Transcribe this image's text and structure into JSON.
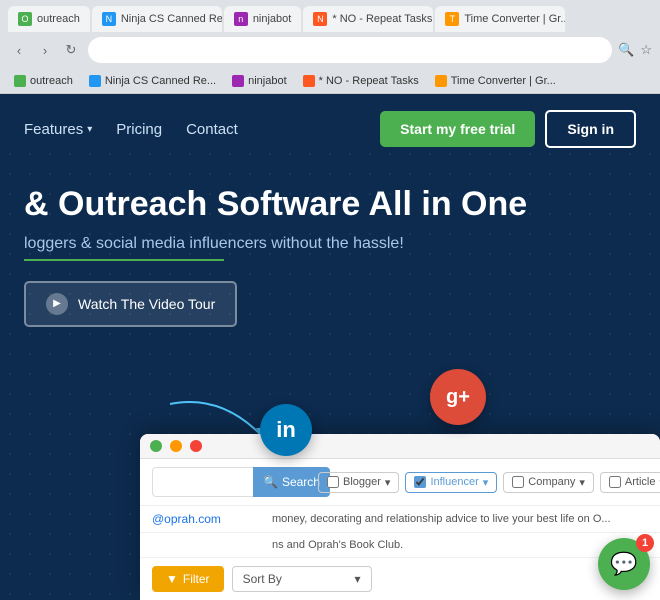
{
  "browser": {
    "tabs": [
      {
        "label": "outreach",
        "favicon_color": "#4caf50",
        "favicon_text": "O"
      },
      {
        "label": "Ninja CS Canned Re...",
        "favicon_color": "#2196f3",
        "favicon_text": "N"
      },
      {
        "label": "ninjabot",
        "favicon_color": "#9c27b0",
        "favicon_text": "n"
      },
      {
        "label": "* NO - Repeat Tasks",
        "favicon_color": "#ff5722",
        "favicon_text": "N"
      },
      {
        "label": "Time Converter | Gr...",
        "favicon_color": "#ff9800",
        "favicon_text": "T"
      }
    ],
    "omnibox_icons": [
      "🔍",
      "★"
    ]
  },
  "bookmarks": [
    {
      "label": "Ninja CS Canned Re...",
      "color": "#4caf50"
    },
    {
      "label": "ninjabot",
      "color": "#9c27b0"
    },
    {
      "label": "* NO - Repeat Tasks",
      "color": "#ff5722"
    },
    {
      "label": "Time Converter | Gr...",
      "color": "#ff9800"
    }
  ],
  "nav": {
    "features_label": "Features",
    "pricing_label": "Pricing",
    "contact_label": "Contact",
    "trial_btn": "Start my free trial",
    "signin_btn": "Sign in"
  },
  "hero": {
    "title": "& Outreach Software All in One",
    "subtitle": "loggers & social media influencers without the hassle!",
    "video_tour_btn": "Watch The Video Tour"
  },
  "dashboard": {
    "search_btn": "Search",
    "filter_btn": "Filter",
    "sort_label": "Sort By",
    "filters": [
      {
        "label": "Blogger",
        "active": false
      },
      {
        "label": "Influencer",
        "active": true
      },
      {
        "label": "Company",
        "active": false
      },
      {
        "label": "Article",
        "active": false
      }
    ],
    "row_email": "@oprah.com",
    "row_desc": "money, decorating and relationship advice to live your best life on O...",
    "row_desc2": "ns and Oprah's Book Club."
  },
  "social": {
    "linkedin_letter": "in",
    "googleplus_symbol": "g+"
  },
  "chat": {
    "badge": "1"
  },
  "colors": {
    "nav_bg": "#0d2b4e",
    "trial_btn": "#4caf50",
    "linkedin": "#0077b5",
    "googleplus": "#dd4b39",
    "chat_btn": "#4caf50"
  }
}
